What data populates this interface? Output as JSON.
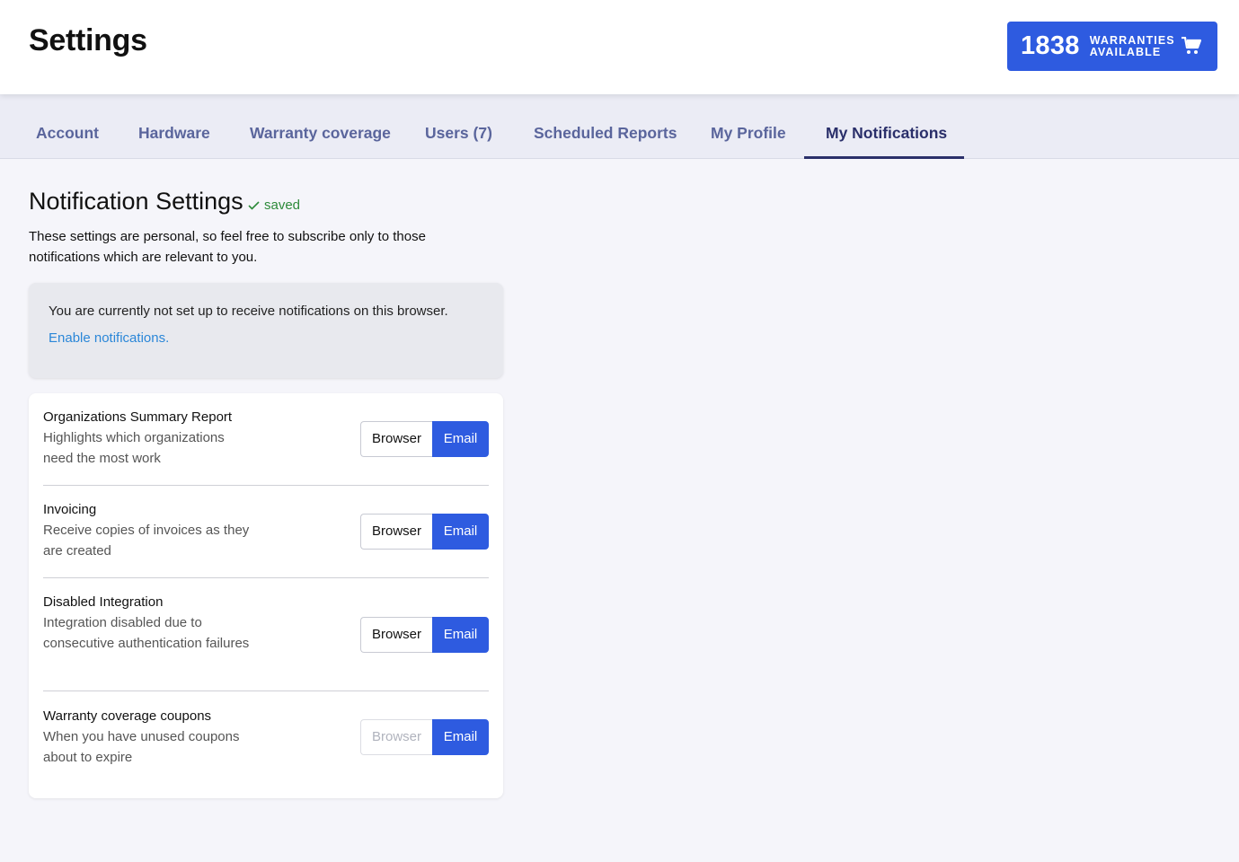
{
  "header": {
    "title": "Settings",
    "warranty_count": "1838",
    "warranty_label_line1": "WARRANTIES",
    "warranty_label_line2": "AVAILABLE",
    "cart_icon": "cart-icon"
  },
  "tabs": [
    {
      "label": "Account",
      "active": false
    },
    {
      "label": "Hardware",
      "active": false
    },
    {
      "label": "Warranty coverage",
      "active": false
    },
    {
      "label": "Users (7)",
      "active": false
    },
    {
      "label": "Scheduled Reports",
      "active": false
    },
    {
      "label": "My Profile",
      "active": false
    },
    {
      "label": "My Notifications",
      "active": true
    }
  ],
  "section": {
    "title": "Notification Settings",
    "saved_label": "saved",
    "description": "These settings are personal, so feel free to subscribe only to those notifications which are relevant to you."
  },
  "notice": {
    "text": "You are currently not set up to receive notifications on this browser.",
    "link": "Enable notifications."
  },
  "notifications": [
    {
      "title": "Organizations Summary Report",
      "description": "Highlights which organizations need the most work",
      "browser_label": "Browser",
      "email_label": "Email",
      "browser_enabled": true
    },
    {
      "title": "Invoicing",
      "description": "Receive copies of invoices as they are created",
      "browser_label": "Browser",
      "email_label": "Email",
      "browser_enabled": true
    },
    {
      "title": "Disabled Integration",
      "description": "Integration disabled due to consecutive authentication failures",
      "browser_label": "Browser",
      "email_label": "Email",
      "browser_enabled": true
    },
    {
      "title": "Warranty coverage coupons",
      "description": "When you have unused coupons about to expire",
      "browser_label": "Browser",
      "email_label": "Email",
      "browser_enabled": false
    }
  ],
  "colors": {
    "accent": "#2e5be0",
    "tab_active": "#2a2f6a",
    "tab_inactive": "#5a659c",
    "saved_green": "#2d8a3a",
    "link": "#2b87d8"
  }
}
